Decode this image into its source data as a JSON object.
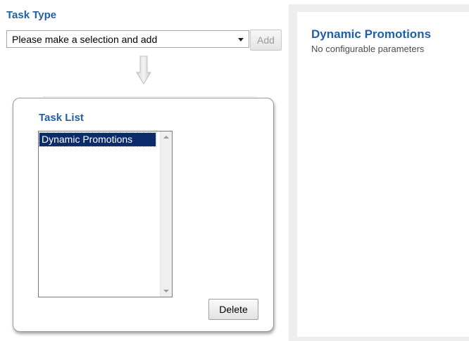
{
  "task_type": {
    "heading": "Task Type",
    "select_value": "Please make a selection and add",
    "add_label": "Add"
  },
  "task_list": {
    "heading": "Task List",
    "items": [
      {
        "label": "Dynamic Promotions",
        "selected": true
      }
    ],
    "delete_label": "Delete"
  },
  "details": {
    "title": "Dynamic Promotions",
    "note": "No configurable parameters"
  },
  "colors": {
    "heading_blue": "#1f5fa7",
    "selection_navy": "#0b2b6b"
  },
  "icons": {
    "dropdown": "chevron-down-icon",
    "flow_arrow": "arrow-down-icon",
    "scroll_up": "scroll-up-icon",
    "scroll_down": "scroll-down-icon"
  }
}
